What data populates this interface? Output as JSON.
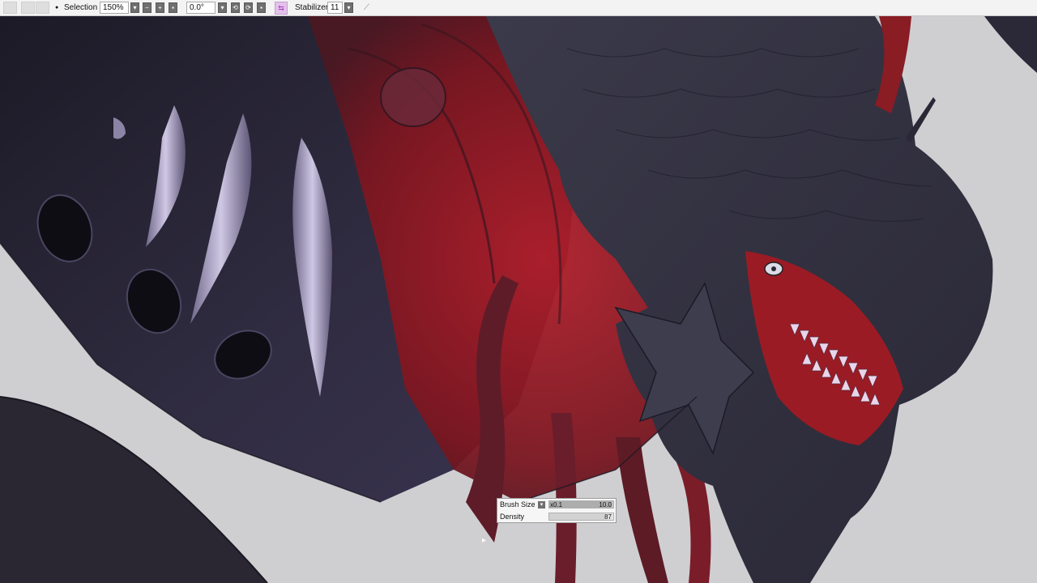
{
  "toolbar": {
    "selection_label": "Selection",
    "zoom_value": "150%",
    "zoom_buttons": [
      "−",
      "+",
      "▪"
    ],
    "rotation_value": "0.0°",
    "rotation_buttons": [
      "⟲",
      "⟳",
      "▪"
    ],
    "stabilizer_label": "Stabilizer",
    "stabilizer_value": "11"
  },
  "brush_popup": {
    "brush_size_label": "Brush Size",
    "brush_size_min": "x0.1",
    "brush_size_value": "10.0",
    "brush_size_fraction": 0.98,
    "density_label": "Density",
    "density_value": "87",
    "density_fraction": 0.87
  },
  "colors": {
    "canvas_bg": "#cfcfd2",
    "accent_button": "#e3c3ea",
    "creature_dark": "#2b2838",
    "creature_red": "#8b1a23"
  },
  "icons": {
    "pen_pressure": "slash-pen-icon",
    "mode": "swap-arrows-icon"
  }
}
